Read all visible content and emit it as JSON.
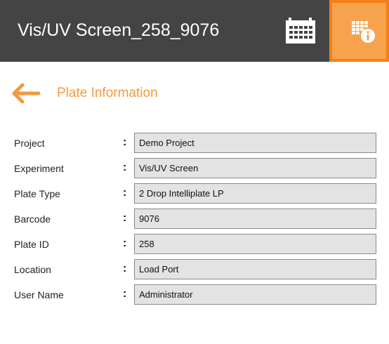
{
  "header": {
    "title": "Vis/UV Screen_258_9076",
    "calendar_icon": "calendar-icon",
    "plate_info_icon": "plate-info-icon"
  },
  "section": {
    "back_icon": "back-arrow-icon",
    "title": "Plate Information"
  },
  "separator": ":",
  "fields": [
    {
      "label": "Project",
      "value": "Demo Project"
    },
    {
      "label": "Experiment",
      "value": "Vis/UV Screen"
    },
    {
      "label": "Plate Type",
      "value": "2 Drop Intelliplate LP"
    },
    {
      "label": "Barcode",
      "value": "9076"
    },
    {
      "label": "Plate ID",
      "value": "258"
    },
    {
      "label": "Location",
      "value": "Load Port"
    },
    {
      "label": "User Name",
      "value": "Administrator"
    }
  ],
  "colors": {
    "header_bg": "#444444",
    "accent": "#f7a24c",
    "accent_border": "#f57f13",
    "title_orange": "#f29a3e",
    "field_bg": "#e3e3e3"
  }
}
